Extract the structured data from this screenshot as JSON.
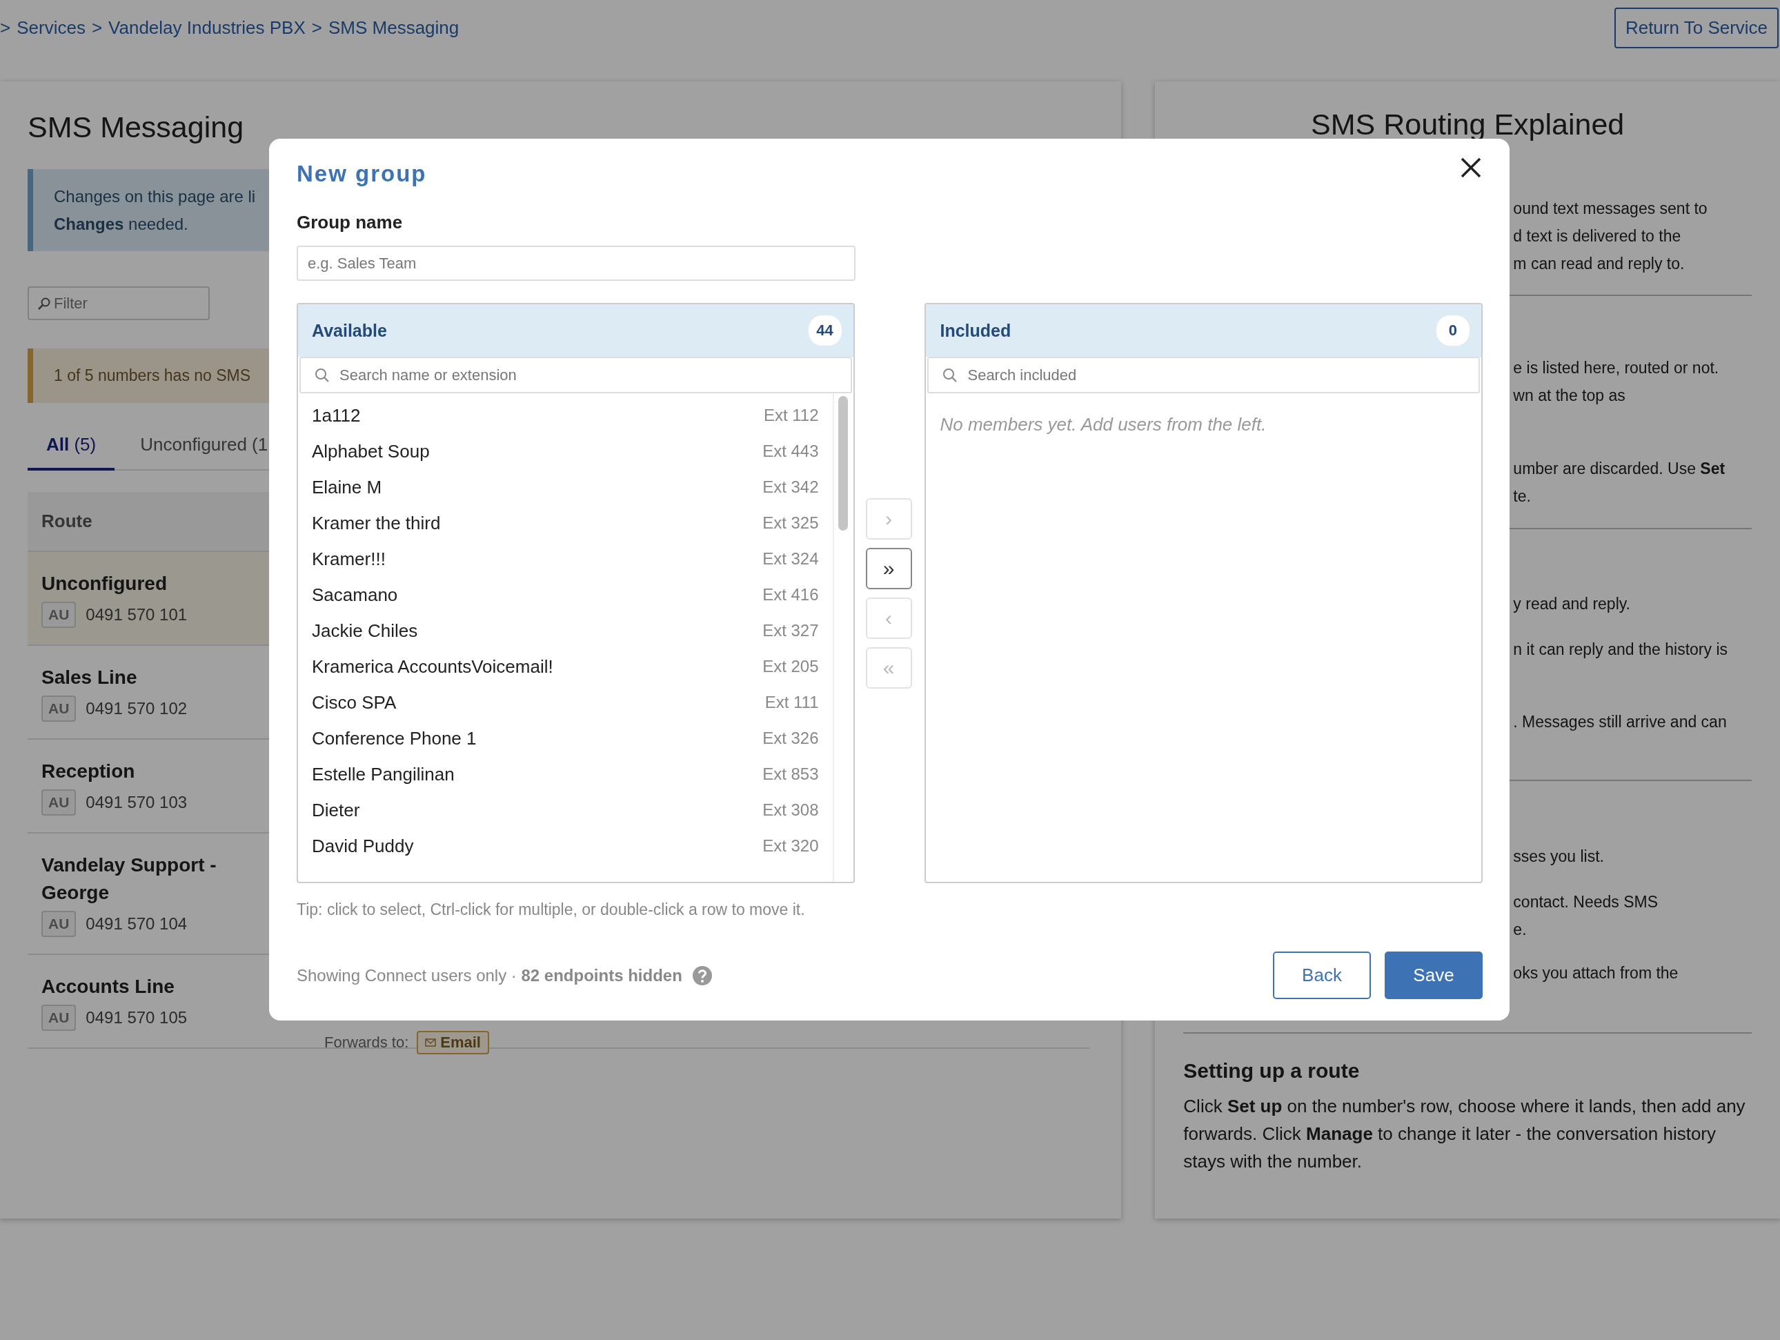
{
  "breadcrumb": {
    "separator": ">",
    "links": [
      "Services",
      "Vandelay Industries PBX",
      "SMS Messaging"
    ]
  },
  "return_button": "Return To Service",
  "sms_panel": {
    "title": "SMS Messaging",
    "notice": "Changes on this page are li\n**Changes** needed.",
    "filter_placeholder": "Filter",
    "warning": "1 of 5 numbers has no SMS",
    "tabs": [
      {
        "label": "**All** (5)",
        "selected": true
      },
      {
        "label": "Unconfigured (1",
        "selected": false
      }
    ],
    "table": {
      "columns": [
        "Route"
      ],
      "rows": [
        {
          "name": "Unconfigured",
          "country": "AU",
          "number": "0491 570 101",
          "highlighted": true
        },
        {
          "name": "Sales Line",
          "country": "AU",
          "number": "0491 570 102",
          "highlighted": false
        },
        {
          "name": "Reception",
          "country": "AU",
          "number": "0491 570 103",
          "highlighted": false
        },
        {
          "name": "Vandelay Support - George",
          "country": "AU",
          "number": "0491 570 104",
          "highlighted": false
        },
        {
          "name": "Accounts Line",
          "country": "AU",
          "number": "0491 570 105",
          "highlighted": false,
          "forwards": {
            "label": "Forwards to:",
            "tag": "Email"
          }
        }
      ]
    }
  },
  "routing_panel": {
    "title": "SMS Routing Explained",
    "sections": [
      {
        "fragments": [
          "ound text messages sent to\nd text is delivered to the\nm can read and reply to."
        ]
      },
      {
        "fragments": [
          "e is listed here, routed or not.\nwn at the top as",
          "umber are discarded. Use **Set**\nte."
        ]
      },
      {
        "fragments": [
          "y read and reply.",
          "n it can reply and the history is",
          ". Messages still arrive and can"
        ]
      },
      {
        "fragments": [
          "sses you list.",
          "contact. Needs SMS\ne.",
          "oks you attach from the"
        ]
      }
    ],
    "heading": "Setting up a route",
    "paragraph": "Click **Set up** on the number's row, choose where it lands, then add any forwards. Click **Manage** to change it later - the conversation history stays with the number."
  },
  "modal": {
    "title": "New group",
    "group_name": {
      "label": "Group name",
      "placeholder": "e.g. Sales Team"
    },
    "available": {
      "title": "Available",
      "count": "44",
      "search_placeholder": "Search name or extension",
      "items": [
        {
          "name": "1a112",
          "ext": "Ext 112"
        },
        {
          "name": "Alphabet Soup",
          "ext": "Ext 443"
        },
        {
          "name": "Elaine M",
          "ext": "Ext 342"
        },
        {
          "name": "Kramer the third",
          "ext": "Ext 325"
        },
        {
          "name": "Kramer!!!",
          "ext": "Ext 324"
        },
        {
          "name": "Sacamano",
          "ext": "Ext 416"
        },
        {
          "name": "Jackie Chiles",
          "ext": "Ext 327"
        },
        {
          "name": "Kramerica AccountsVoicemail!",
          "ext": "Ext 205"
        },
        {
          "name": "Cisco SPA",
          "ext": "Ext 111"
        },
        {
          "name": "Conference Phone 1",
          "ext": "Ext 326"
        },
        {
          "name": "Estelle Pangilinan",
          "ext": "Ext 853"
        },
        {
          "name": "Dieter",
          "ext": "Ext 308"
        },
        {
          "name": "David Puddy",
          "ext": "Ext 320"
        }
      ]
    },
    "transfer_buttons": [
      {
        "label": "›",
        "disabled": true
      },
      {
        "label": "»",
        "disabled": false
      },
      {
        "label": "‹",
        "disabled": true
      },
      {
        "label": "«",
        "disabled": true
      }
    ],
    "included": {
      "title": "Included",
      "count": "0",
      "search_placeholder": "Search included",
      "empty": "No members yet. Add users from the left."
    },
    "tip": "Tip: click to select, Ctrl-click for multiple, or double-click a row to move it.",
    "footer": "Showing Connect users only · **82 endpoints hidden**",
    "buttons": [
      {
        "label": "Back",
        "kind": "secondary"
      },
      {
        "label": "Save",
        "kind": "primary"
      }
    ]
  }
}
